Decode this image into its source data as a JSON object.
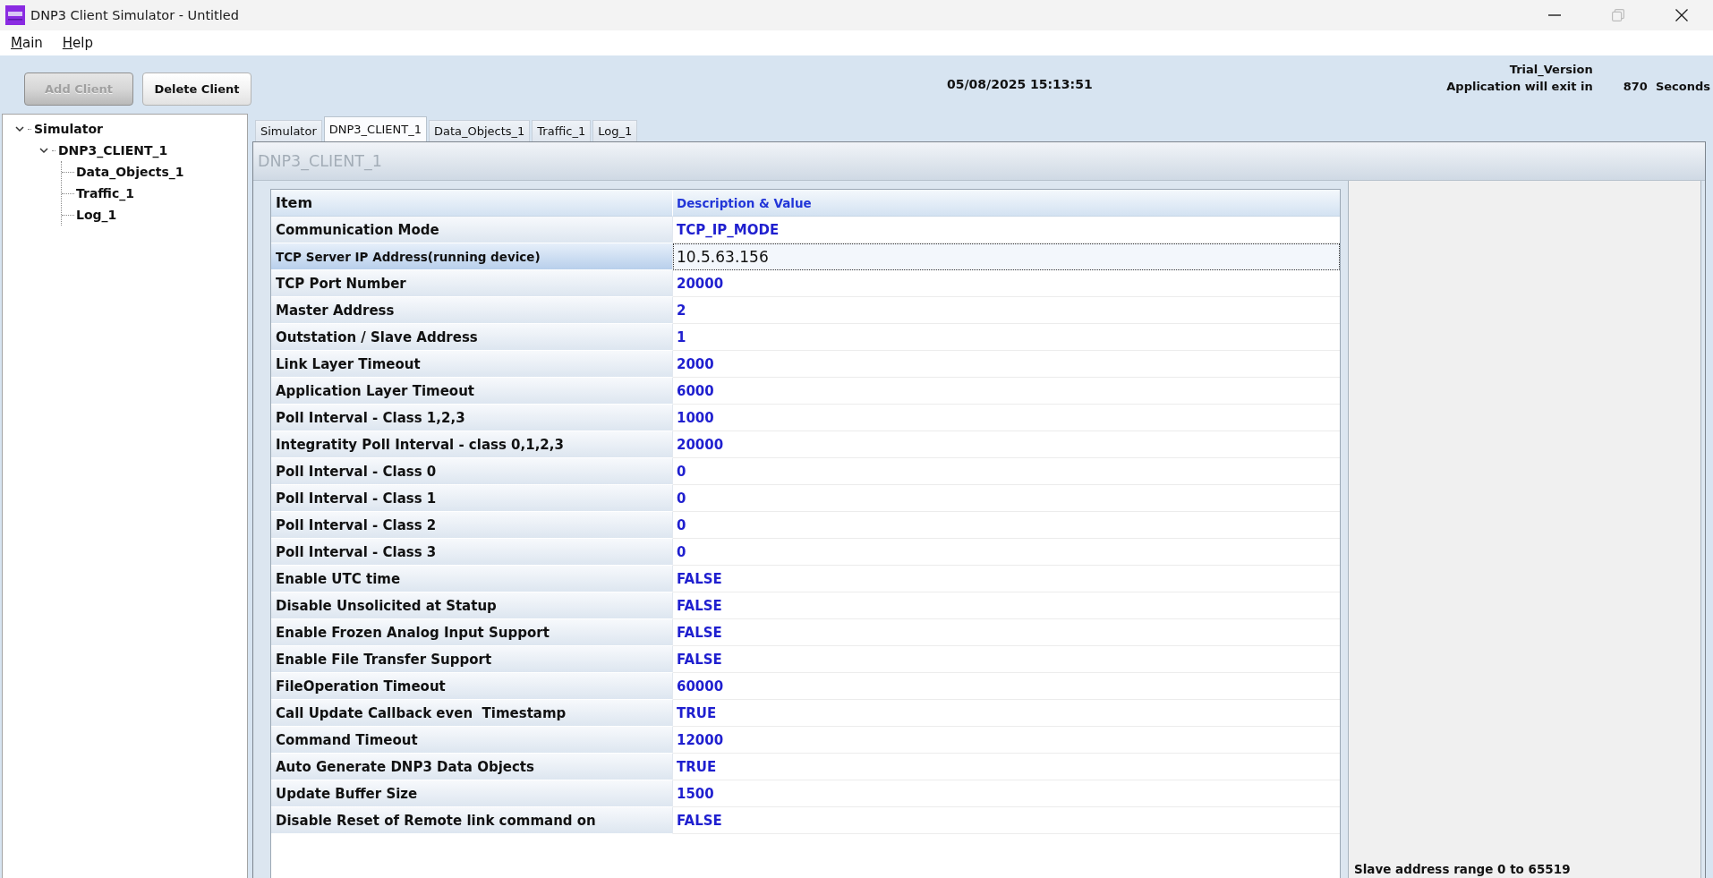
{
  "window": {
    "title": "DNP3 Client Simulator - Untitled",
    "controls": [
      {
        "kind": "minimize",
        "disabled": false
      },
      {
        "kind": "restore",
        "disabled": true
      },
      {
        "kind": "close",
        "disabled": false
      }
    ]
  },
  "menu": [
    {
      "label": "Main"
    },
    {
      "label": "Help"
    }
  ],
  "toolbar": {
    "buttons": [
      {
        "label": "Add Client",
        "disabled": true
      },
      {
        "label": "Delete Client",
        "disabled": false
      }
    ],
    "datetime": "05/08/2025 15:13:51",
    "trial": {
      "edition": "Trial_Version",
      "message": "Application will exit in",
      "seconds": "870",
      "unit": "Seconds"
    }
  },
  "tree": [
    {
      "label": "Simulator",
      "expanded": true,
      "children": [
        {
          "label": "DNP3_CLIENT_1",
          "expanded": true,
          "children": [
            {
              "label": "Data_Objects_1"
            },
            {
              "label": "Traffic_1"
            },
            {
              "label": "Log_1"
            }
          ]
        }
      ]
    }
  ],
  "tabs": [
    {
      "label": "Simulator",
      "selected": false
    },
    {
      "label": "DNP3_CLIENT_1",
      "selected": true
    },
    {
      "label": "Data_Objects_1",
      "selected": false
    },
    {
      "label": "Traffic_1",
      "selected": false
    },
    {
      "label": "Log_1",
      "selected": false
    }
  ],
  "panel": {
    "title": "DNP3_CLIENT_1",
    "table": {
      "columns": [
        "Item",
        "Description & Value"
      ],
      "rows": [
        {
          "item": "Communication Mode",
          "value": "TCP_IP_MODE",
          "selected": false
        },
        {
          "item": "TCP Server IP Address(running device)",
          "value": "10.5.63.156",
          "selected": true
        },
        {
          "item": "TCP Port Number",
          "value": "20000",
          "selected": false
        },
        {
          "item": "Master Address",
          "value": "2",
          "selected": false
        },
        {
          "item": "Outstation / Slave Address",
          "value": "1",
          "selected": false
        },
        {
          "item": "Link Layer Timeout",
          "value": "2000",
          "selected": false
        },
        {
          "item": "Application Layer Timeout",
          "value": "6000",
          "selected": false
        },
        {
          "item": "Poll Interval - Class 1,2,3",
          "value": "1000",
          "selected": false
        },
        {
          "item": "Integratity Poll Interval - class 0,1,2,3",
          "value": "20000",
          "selected": false
        },
        {
          "item": "Poll Interval - Class 0",
          "value": "0",
          "selected": false
        },
        {
          "item": "Poll Interval - Class 1",
          "value": "0",
          "selected": false
        },
        {
          "item": "Poll Interval - Class 2",
          "value": "0",
          "selected": false
        },
        {
          "item": "Poll Interval - Class 3",
          "value": "0",
          "selected": false
        },
        {
          "item": "Enable UTC time",
          "value": "FALSE",
          "selected": false
        },
        {
          "item": "Disable Unsolicited at Statup",
          "value": "FALSE",
          "selected": false
        },
        {
          "item": "Enable Frozen Analog Input Support",
          "value": "FALSE",
          "selected": false
        },
        {
          "item": "Enable File Transfer Support",
          "value": "FALSE",
          "selected": false
        },
        {
          "item": "FileOperation Timeout",
          "value": "60000",
          "selected": false
        },
        {
          "item": "Call Update Callback even  Timestamp",
          "value": "TRUE",
          "selected": false
        },
        {
          "item": "Command Timeout",
          "value": "12000",
          "selected": false
        },
        {
          "item": "Auto Generate DNP3 Data Objects",
          "value": "TRUE",
          "selected": false
        },
        {
          "item": "Update Buffer Size",
          "value": "1500",
          "selected": false
        },
        {
          "item": "Disable Reset of Remote link command on",
          "value": "FALSE",
          "selected": false
        }
      ]
    },
    "hint": "Slave address range 0 to 65519"
  }
}
